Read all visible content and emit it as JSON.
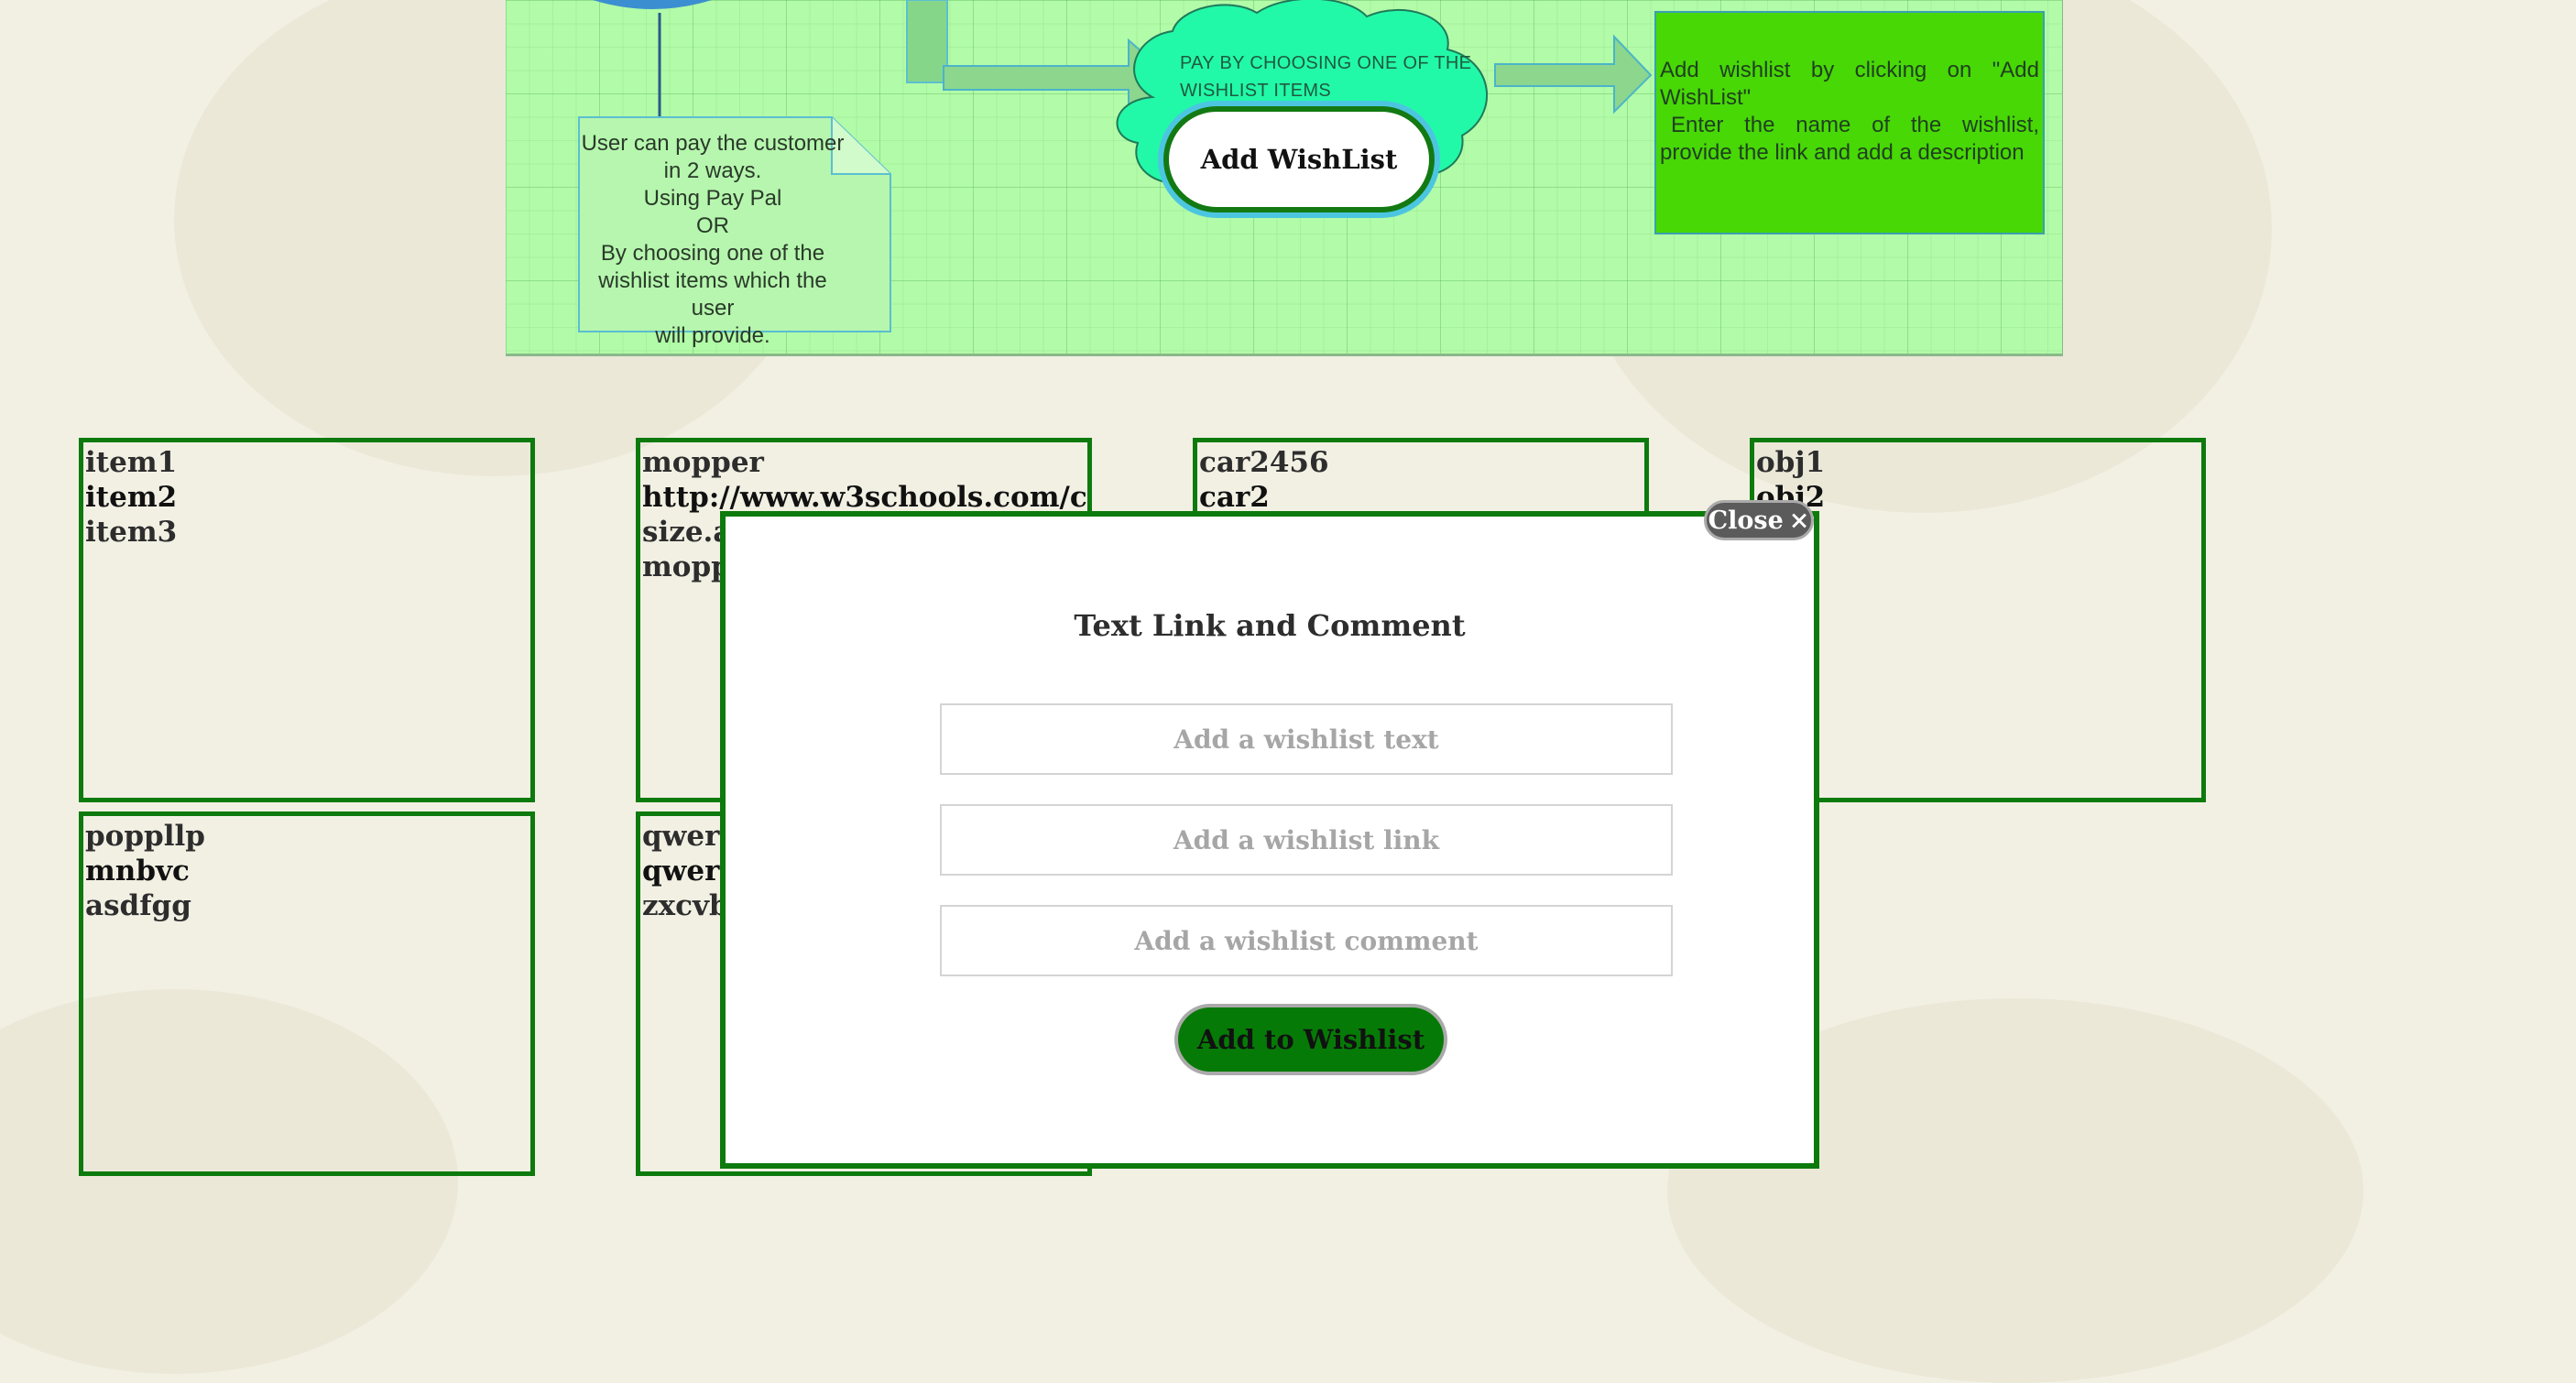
{
  "diagram": {
    "note_lines": [
      "User can pay the customer",
      "in 2 ways.",
      "Using Pay Pal",
      "OR",
      "By choosing one of the",
      "wishlist items which the user",
      "will provide."
    ],
    "cloud_line1": "PAY BY CHOOSING ONE OF THE",
    "cloud_line2": "WISHLIST ITEMS",
    "pill_label": "Add WishList",
    "green_line1": "Add wishlist by clicking on \"Add WishList\"",
    "green_line2": "Enter the name of the wishlist, provide the link and add a description",
    "colors": {
      "background": "#b2fba8",
      "box": "#47d805",
      "cloud": "#22f9a8",
      "border": "#137a13"
    }
  },
  "wishlists": [
    {
      "items": [
        "item1",
        "item2",
        "item3"
      ]
    },
    {
      "items": [
        "mopper",
        "http://www.w3schools.com/c",
        "size.a",
        "mopp"
      ]
    },
    {
      "items": [
        "car2456",
        "car2"
      ]
    },
    {
      "items": [
        "obj1",
        "obj2"
      ]
    },
    {
      "items": [
        "poppllp",
        "mnbvc",
        "asdfgg"
      ]
    },
    {
      "items": [
        "qwer",
        "qwer",
        "zxcvb"
      ]
    }
  ],
  "modal": {
    "close_label": "Close",
    "close_icon": "×",
    "title": "Text Link and Comment",
    "text_placeholder": "Add a wishlist text",
    "link_placeholder": "Add a wishlist link",
    "comment_placeholder": "Add a wishlist comment",
    "submit_label": "Add to Wishlist"
  },
  "theme": {
    "accent": "#0d7a0d",
    "page_bg": "#f2f0e3",
    "button_bg": "#067a06"
  }
}
